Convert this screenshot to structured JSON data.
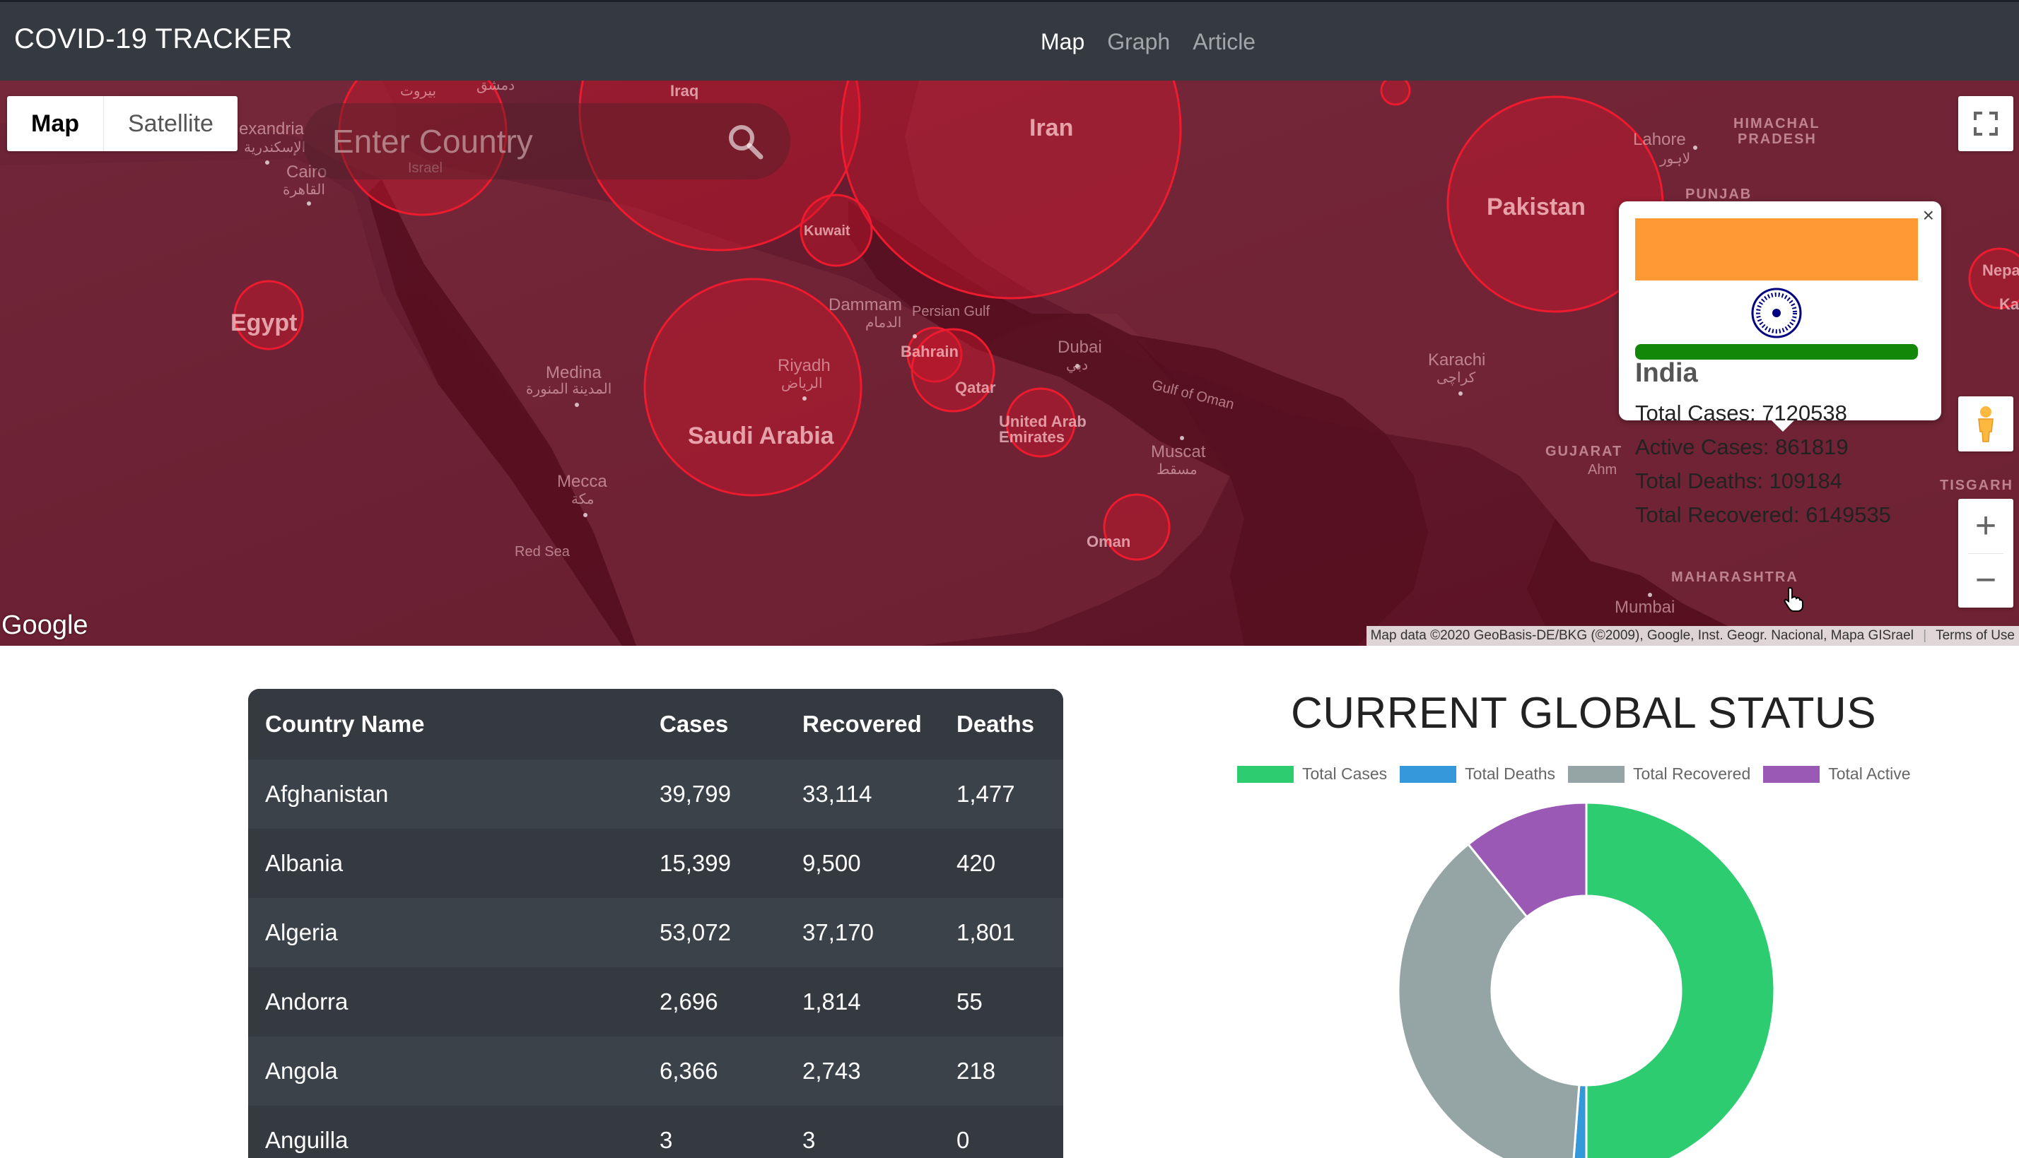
{
  "navbar": {
    "brand": "COVID-19 TRACKER",
    "links": [
      {
        "label": "Map",
        "active": true
      },
      {
        "label": "Graph",
        "active": false
      },
      {
        "label": "Article",
        "active": false
      }
    ]
  },
  "map": {
    "map_type": {
      "map_label": "Map",
      "satellite_label": "Satellite",
      "selected": "Map"
    },
    "search": {
      "placeholder": "Enter Country",
      "icon": "search-icon"
    },
    "country_labels": {
      "iran": "Iran",
      "pakistan": "Pakistan",
      "saudi_arabia": "Saudi Arabia",
      "egypt": "Egypt",
      "kuwait": "Kuwait",
      "bahrain": "Bahrain",
      "qatar": "Qatar",
      "uae": "United Arab Emirates",
      "oman": "Oman",
      "iraq": "Iraq",
      "israel": "Israel",
      "nepal": "Nepa",
      "ka": "Ka"
    },
    "place_labels": {
      "alexandria": "exandria",
      "alexandria_ar": "الإسكندرية",
      "cairo": "Cairo",
      "cairo_ar": "القاهرة",
      "medina": "Medina",
      "medina_ar": "المدينة المنورة",
      "mecca": "Mecca",
      "mecca_ar": "مكة",
      "riyadh": "Riyadh",
      "riyadh_ar": "الرياض",
      "dammam": "Dammam",
      "dammam_ar": "الدمام",
      "dubai": "Dubai",
      "dubai_ar": "دبي",
      "muscat": "Muscat",
      "muscat_ar": "مسقط",
      "karachi": "Karachi",
      "karachi_ar": "کراچی",
      "lahore": "Lahore",
      "lahore_ar": "لاہور",
      "mumbai": "Mumbai",
      "persian_gulf": "Persian Gulf",
      "gulf_of_oman": "Gulf of Oman",
      "red_sea": "Red Sea",
      "himachal": "HIMACHAL",
      "pradesh": "PRADESH",
      "punjab": "PUNJAB",
      "gujarat": "GUJARAT",
      "ahm": "Ahm",
      "maharashtra": "MAHARASHTRA",
      "tisgarh": "TISGARH",
      "beirut": "بيروت",
      "damascus": "دمشق"
    },
    "google_logo": "Google",
    "attribution": "Map data ©2020 GeoBasis-DE/BKG (©2009), Google, Inst. Geogr. Nacional, Mapa GISrael",
    "terms": "Terms of Use",
    "controls": {
      "fullscreen_icon": "fullscreen-icon",
      "pegman_icon": "pegman-icon",
      "zoom_in": "+",
      "zoom_out": "−"
    },
    "info_window": {
      "close": "×",
      "country": "India",
      "total_cases": "Total Cases: 7120538",
      "active_cases": "Active Cases: 861819",
      "total_deaths": "Total Deaths: 109184",
      "total_recovered": "Total Recovered: 6149535"
    }
  },
  "table": {
    "headers": {
      "country": "Country Name",
      "cases": "Cases",
      "recovered": "Recovered",
      "deaths": "Deaths"
    },
    "rows": [
      {
        "country": "Afghanistan",
        "cases": "39,799",
        "recovered": "33,114",
        "deaths": "1,477"
      },
      {
        "country": "Albania",
        "cases": "15,399",
        "recovered": "9,500",
        "deaths": "420"
      },
      {
        "country": "Algeria",
        "cases": "53,072",
        "recovered": "37,170",
        "deaths": "1,801"
      },
      {
        "country": "Andorra",
        "cases": "2,696",
        "recovered": "1,814",
        "deaths": "55"
      },
      {
        "country": "Angola",
        "cases": "6,366",
        "recovered": "2,743",
        "deaths": "218"
      },
      {
        "country": "Anguilla",
        "cases": "3",
        "recovered": "3",
        "deaths": "0"
      }
    ]
  },
  "chart_data": {
    "type": "pie",
    "title": "CURRENT GLOBAL STATUS",
    "categories": [
      "Total Cases",
      "Total Deaths",
      "Total Recovered",
      "Total Active"
    ],
    "values": [
      50,
      1.2,
      38,
      10.8
    ],
    "colors": [
      "#2ecc71",
      "#3498db",
      "#95a5a6",
      "#9b59b6"
    ],
    "legend_position": "top",
    "donut": true
  },
  "colors": {
    "navbar_bg": "#343a40",
    "circle_fill": "#d4162a",
    "table_bg": "#343a40",
    "india_saffron": "#ff9933",
    "india_green": "#138808",
    "chakra": "#000080"
  }
}
